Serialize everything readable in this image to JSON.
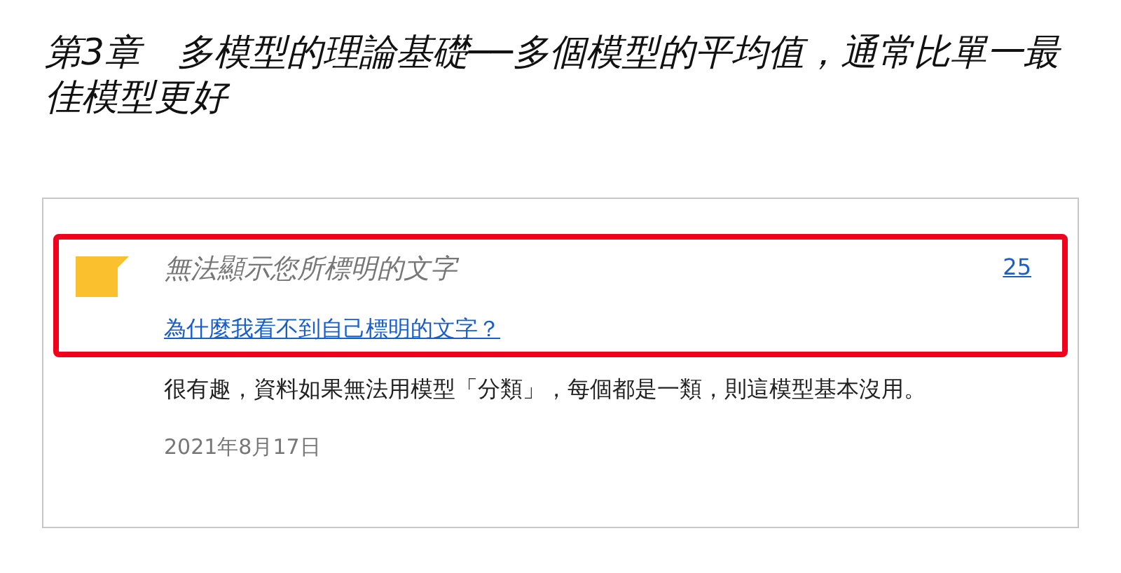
{
  "chapter_title": "第3章　多模型的理論基礎──多個模型的平均值，通常比單一最佳模型更好",
  "highlight": {
    "color": "#fbc02d",
    "text": "無法顯示您所標明的文字",
    "location": "25",
    "help_link": "為什麼我看不到自己標明的文字？"
  },
  "note": "很有趣，資料如果無法用模型「分類」，每個都是一類，則這模型基本沒用。",
  "date": "2021年8月17日"
}
